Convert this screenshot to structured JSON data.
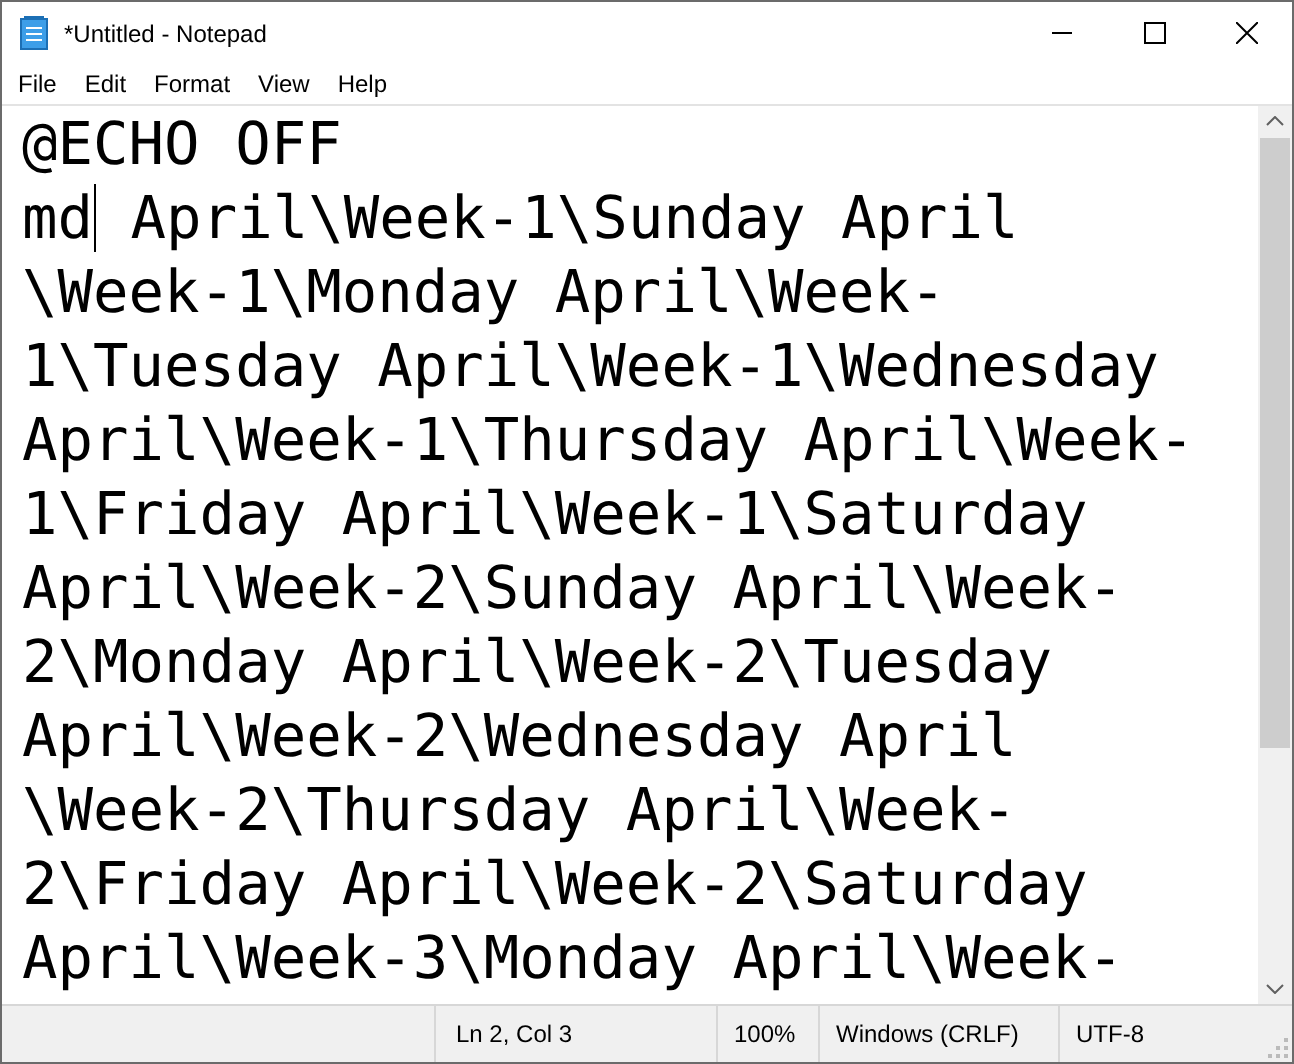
{
  "window": {
    "title": "*Untitled - Notepad"
  },
  "menu": [
    "File",
    "Edit",
    "Format",
    "View",
    "Help"
  ],
  "editor": {
    "lines": [
      {
        "text": "@ECHO OFF"
      },
      {
        "text": "md",
        "after_caret": " April\\Week-1\\Sunday April"
      },
      {
        "text": "\\Week-1\\Monday April\\Week-"
      },
      {
        "text": "1\\Tuesday April\\Week-1\\Wednesday"
      },
      {
        "text": "April\\Week-1\\Thursday April\\Week-"
      },
      {
        "text": "1\\Friday April\\Week-1\\Saturday"
      },
      {
        "text": "April\\Week-2\\Sunday April\\Week-"
      },
      {
        "text": "2\\Monday April\\Week-2\\Tuesday"
      },
      {
        "text": "April\\Week-2\\Wednesday April"
      },
      {
        "text": "\\Week-2\\Thursday April\\Week-"
      },
      {
        "text": "2\\Friday April\\Week-2\\Saturday"
      },
      {
        "text": "April\\Week-3\\Monday April\\Week-"
      }
    ]
  },
  "status_bar": {
    "position": "Ln 2, Col 3",
    "zoom": "100%",
    "line_ending": "Windows (CRLF)",
    "encoding": "UTF-8"
  }
}
